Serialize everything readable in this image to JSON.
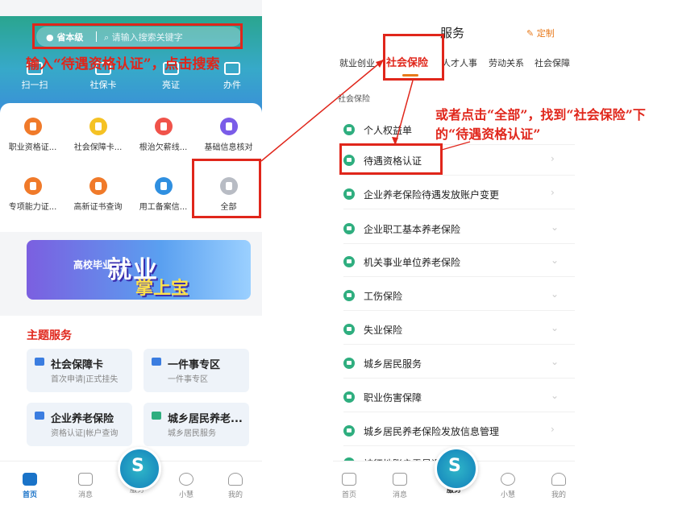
{
  "left": {
    "search": {
      "location": "省本级",
      "placeholder": "请输入搜索关键字"
    },
    "annotation": "输入“待遇资格认证”，点击搜索",
    "quick_actions": [
      "扫一扫",
      "社保卡",
      "亮证",
      "办件"
    ],
    "services": [
      {
        "label": "职业资格证...",
        "color": "#f07a2a"
      },
      {
        "label": "社会保障卡...",
        "color": "#f5c224"
      },
      {
        "label": "根治欠薪线...",
        "color": "#f0534a"
      },
      {
        "label": "基础信息核对",
        "color": "#7a5ce8"
      },
      {
        "label": "专项能力证...",
        "color": "#f07a2a"
      },
      {
        "label": "高新证书查询",
        "color": "#f07a2a"
      },
      {
        "label": "用工备案信...",
        "color": "#2f8fe0"
      },
      {
        "label": "全部",
        "color": "#b8bcc4"
      }
    ],
    "banner": {
      "small": "高校毕业生",
      "big": "就业",
      "sub": "掌上宝"
    },
    "theme_title": "主题服务",
    "theme_cards": [
      {
        "title": "社会保障卡",
        "subtitle": "首次申请|正式挂失",
        "color": "#3b7de0"
      },
      {
        "title": "一件事专区",
        "subtitle": "一件事专区",
        "color": "#3b7de0"
      },
      {
        "title": "企业养老保险",
        "subtitle": "资格认证|帐户查询",
        "color": "#3b7de0"
      },
      {
        "title": "城乡居民养老...",
        "subtitle": "城乡居民服务",
        "color": "#2fae7f"
      }
    ],
    "tabs": [
      "首页",
      "消息",
      "服务",
      "小慧",
      "我的"
    ]
  },
  "right": {
    "title": "服务",
    "custom": "定制",
    "tabs": [
      "就业创业",
      "社会保险",
      "人才人事",
      "劳动关系",
      "社会保障"
    ],
    "section": "社会保险",
    "items": [
      "个人权益单",
      "待遇资格认证",
      "企业养老保险待遇发放账户变更",
      "企业职工基本养老保险",
      "机关事业单位养老保险",
      "工伤保险",
      "失业保险",
      "城乡居民服务",
      "职业伤害保障",
      "城乡居民养老保险发放信息管理",
      "被征地账户零星退"
    ],
    "annotation": "或者点击“全部”，找到“社会保险”下的“待遇资格认证”",
    "tabs_bottom": [
      "首页",
      "消息",
      "服务",
      "小慧",
      "我的"
    ]
  },
  "colors": {
    "accent_red": "#e0261b",
    "green": "#2fae7f"
  }
}
